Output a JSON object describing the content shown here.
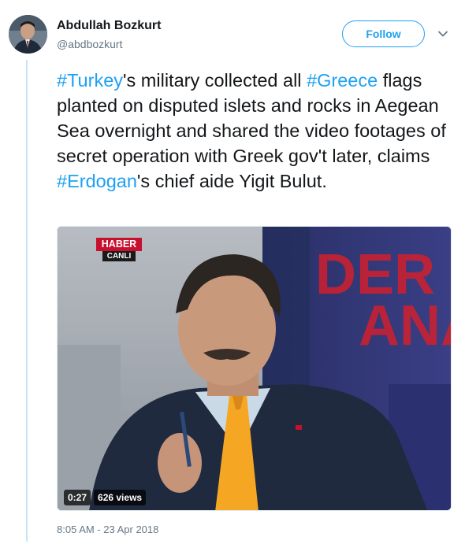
{
  "author": {
    "name": "Abdullah Bozkurt",
    "handle": "@abdbozkurt",
    "avatar_icon": "profile-photo"
  },
  "actions": {
    "follow_label": "Follow",
    "more_icon": "chevron-down-icon"
  },
  "tweet": {
    "segments": [
      {
        "text": "#Turkey",
        "type": "hashtag"
      },
      {
        "text": "'s military collected all ",
        "type": "text"
      },
      {
        "text": "#Greece",
        "type": "hashtag"
      },
      {
        "text": " flags planted on disputed islets and rocks in Aegean Sea overnight and shared the video footages of secret operation with Greek gov't later, claims ",
        "type": "text"
      },
      {
        "text": "#Erdogan",
        "type": "hashtag"
      },
      {
        "text": "'s chief aide Yigit Bulut.",
        "type": "text"
      }
    ],
    "timestamp": "8:05 AM - 23 Apr 2018"
  },
  "media": {
    "duration": "0:27",
    "views": "626 views",
    "channel_logo_top": "HABER",
    "channel_logo_bottom": "CANLI",
    "backdrop_text_top": "DER",
    "backdrop_text_bottom": "ANA"
  },
  "colors": {
    "link": "#1da1f2",
    "text": "#14171a",
    "muted": "#657786",
    "thread_line": "#c8e4f3"
  }
}
